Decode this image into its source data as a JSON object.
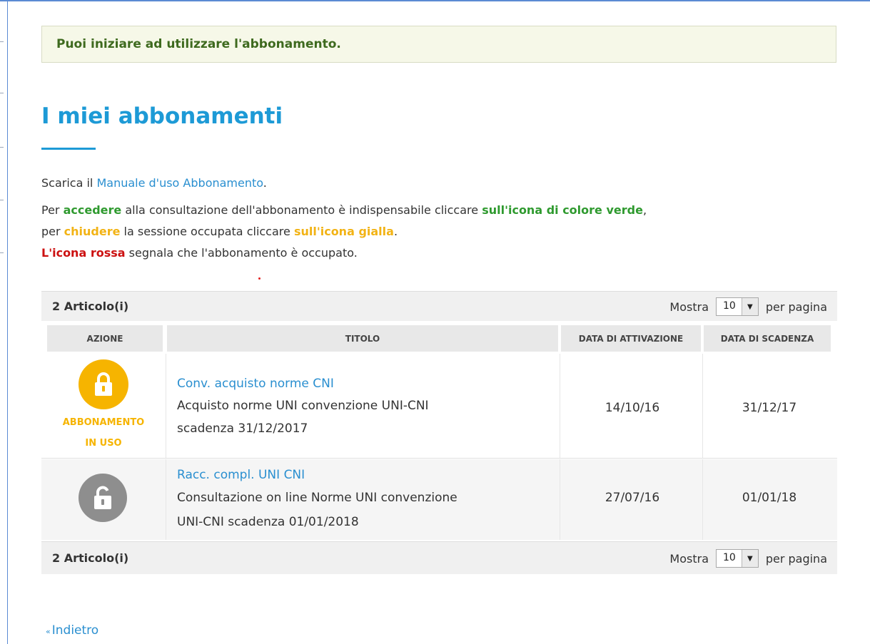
{
  "notice": {
    "text": "Puoi iniziare ad utilizzare l'abbonamento."
  },
  "page": {
    "title": "I miei abbonamenti"
  },
  "intro": {
    "line1": {
      "prefix": "Scarica il ",
      "link": "Manuale d'uso Abbonamento",
      "suffix": "."
    },
    "line2": {
      "a": "Per ",
      "accedere": "accedere",
      "b": " alla consultazione dell'abbonamento è indispensabile cliccare ",
      "green_icon": "sull'icona di colore verde",
      "c": ","
    },
    "line3": {
      "a": "per ",
      "chiudere": "chiudere",
      "b": " la sessione occupata cliccare ",
      "yellow_icon": "sull'icona gialla",
      "c": "."
    },
    "line4": {
      "red_icon": "L'icona rossa",
      "rest": " segnala che l'abbonamento è occupato."
    }
  },
  "table": {
    "count_label": "2 Articolo(i)",
    "pager": {
      "show_label": "Mostra",
      "per_page_value": "10",
      "per_page_label": "per pagina"
    },
    "headers": {
      "action": "AZIONE",
      "title": "TITOLO",
      "activation": "DATA DI ATTIVAZIONE",
      "expiry": "DATA DI SCADENZA"
    },
    "rows": [
      {
        "icon": "lock-closed-icon",
        "icon_color": "#f6b400",
        "status_line1": "ABBONAMENTO",
        "status_line2": "IN USO",
        "title": "Conv. acquisto norme CNI",
        "desc_line1": "Acquisto norme UNI convenzione UNI-CNI",
        "desc_line2": "scadenza 31/12/2017",
        "activation": "14/10/16",
        "expiry": "31/12/17"
      },
      {
        "icon": "lock-open-icon",
        "icon_color": "#8e8e8e",
        "title": "Racc. compl. UNI CNI",
        "desc_line1": "Consultazione on line Norme UNI convenzione",
        "desc_line2": "UNI-CNI scadenza 01/01/2018",
        "activation": "27/07/16",
        "expiry": "01/01/18"
      }
    ]
  },
  "back": {
    "arrow": "«",
    "label": "Indietro"
  },
  "colors": {
    "accent": "#1d9ad6",
    "link": "#2a8fd0",
    "green": "#2f9a2f",
    "yellow": "#f2b315",
    "red": "#cc1111"
  }
}
